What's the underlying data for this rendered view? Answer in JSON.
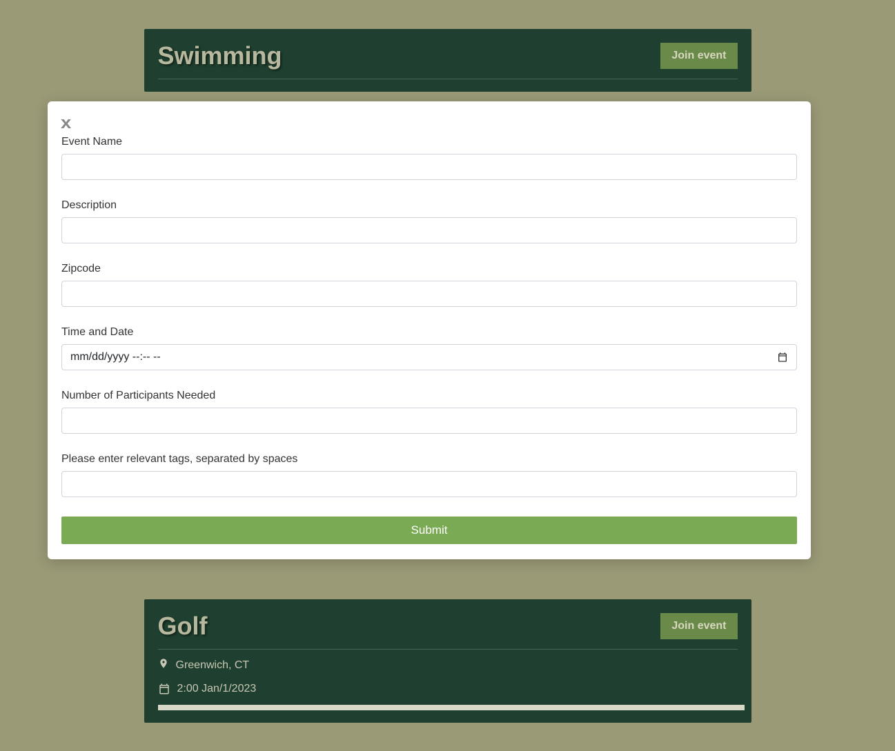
{
  "events": [
    {
      "title": "Swimming",
      "join_label": "Join event"
    },
    {
      "title": "Golf",
      "join_label": "Join event",
      "location": "Greenwich, CT",
      "datetime": "2:00 Jan/1/2023"
    }
  ],
  "modal": {
    "close_label": "x",
    "fields": {
      "event_name": {
        "label": "Event Name",
        "value": ""
      },
      "description": {
        "label": "Description",
        "value": ""
      },
      "zipcode": {
        "label": "Zipcode",
        "value": ""
      },
      "time_date": {
        "label": "Time and Date",
        "placeholder": "mm/dd/yyyy --:-- --",
        "value": ""
      },
      "participants": {
        "label": "Number of Participants Needed",
        "value": ""
      },
      "tags": {
        "label": "Please enter relevant tags, separated by spaces",
        "value": ""
      }
    },
    "submit_label": "Submit"
  }
}
